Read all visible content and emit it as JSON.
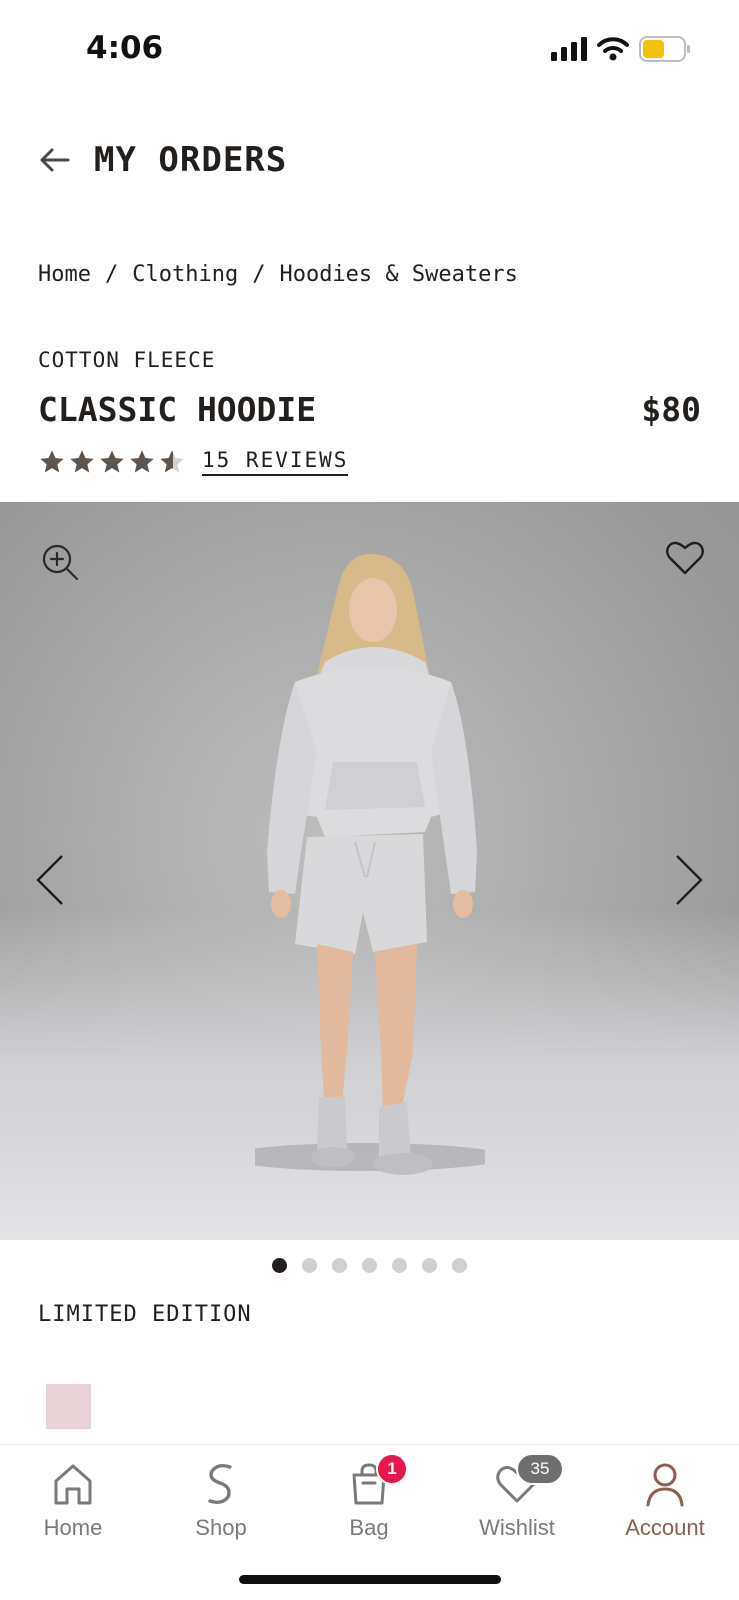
{
  "status_bar": {
    "time": "4:06"
  },
  "header": {
    "title": "MY ORDERS"
  },
  "breadcrumb": {
    "items": [
      "Home",
      "/",
      "Clothing",
      "/",
      "Hoodies & Sweaters"
    ]
  },
  "product": {
    "collection": "COTTON FLEECE",
    "name": "CLASSIC HOODIE",
    "price": "$80",
    "rating": 4.5,
    "reviews_label": "15 REVIEWS",
    "edition": "LIMITED EDITION",
    "swatch_color": "#e8d3d8"
  },
  "gallery": {
    "image_count": 7,
    "active_index": 0
  },
  "tab_bar": {
    "home": "Home",
    "shop": "Shop",
    "bag": "Bag",
    "bag_badge": "1",
    "wishlist": "Wishlist",
    "wishlist_badge": "35",
    "account": "Account"
  },
  "colors": {
    "text": "#231f1c",
    "accent": "#8b5e4f",
    "badge_red": "#e8174a"
  }
}
